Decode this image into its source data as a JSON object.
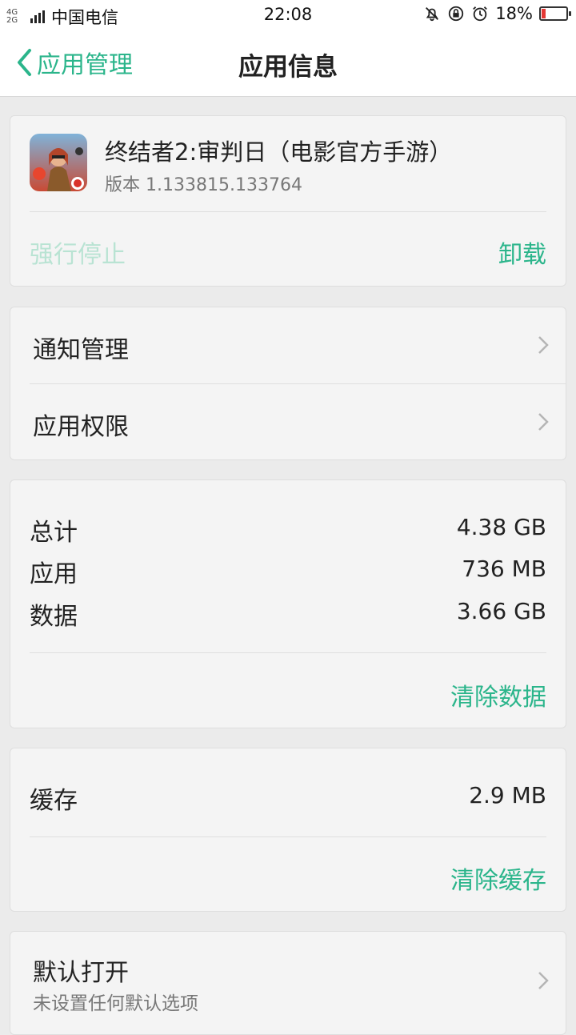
{
  "status_bar": {
    "network_top": "4G",
    "network_bottom": "2G",
    "carrier": "中国电信",
    "time": "22:08",
    "battery_percent": "18%",
    "battery_level": 0.18,
    "icons": [
      "mute-icon",
      "rotation-lock-icon",
      "alarm-icon",
      "battery-icon"
    ]
  },
  "nav": {
    "back_label": "应用管理",
    "title": "应用信息"
  },
  "app": {
    "name": "终结者2:审判日（电影官方手游）",
    "version": "版本 1.133815.133764",
    "force_stop": "强行停止",
    "uninstall": "卸载"
  },
  "settings": {
    "notification": "通知管理",
    "permissions": "应用权限"
  },
  "storage": {
    "total_label": "总计",
    "total_value": "4.38 GB",
    "app_label": "应用",
    "app_value": "736 MB",
    "data_label": "数据",
    "data_value": "3.66 GB",
    "clear_data": "清除数据"
  },
  "cache": {
    "label": "缓存",
    "value": "2.9 MB",
    "clear_cache": "清除缓存"
  },
  "default_open": {
    "label": "默认打开",
    "sublabel": "未设置任何默认选项"
  },
  "colors": {
    "accent": "#2bb58b",
    "accent_disabled": "#b9e3d3",
    "background": "#ebebeb",
    "card": "#f4f4f4",
    "battery_low": "#e53935"
  }
}
